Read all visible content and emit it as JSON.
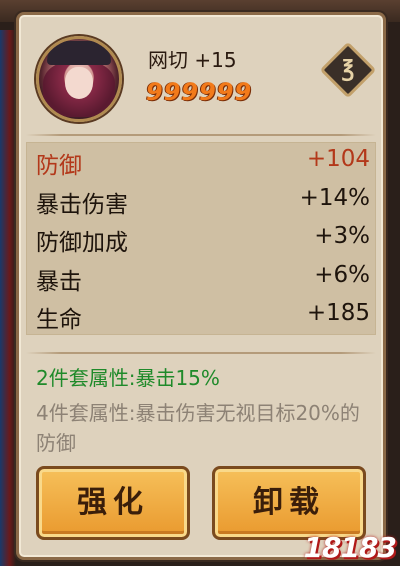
{
  "item": {
    "name_level": "网切 +15",
    "rating": "999999",
    "lock_icon": "lock-icon"
  },
  "stats": [
    {
      "label": "防御",
      "value": "+104",
      "main": true
    },
    {
      "label": "暴击伤害",
      "value": "+14%",
      "main": false
    },
    {
      "label": "防御加成",
      "value": "+3%",
      "main": false
    },
    {
      "label": "暴击",
      "value": "+6%",
      "main": false
    },
    {
      "label": "生命",
      "value": "+185",
      "main": false
    }
  ],
  "set_bonus": {
    "two_piece": "2件套属性:暴击15%",
    "four_piece": "4件套属性:暴击伤害无视目标20%的防御"
  },
  "buttons": {
    "upgrade": "强化",
    "unequip": "卸载"
  },
  "watermark": "18183",
  "colors": {
    "main_stat": "#b3381a",
    "set_active": "#1f8a2a",
    "set_inactive": "#8d8275",
    "rating": "#f27a1a",
    "button": "#e9992e"
  }
}
